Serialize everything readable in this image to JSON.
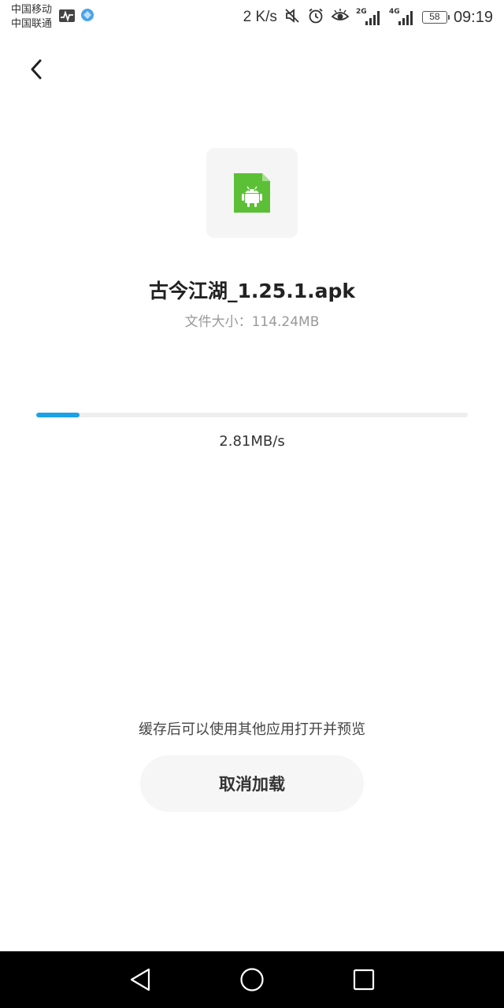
{
  "status_bar": {
    "carrier_1": "中国移动",
    "carrier_2": "中国联通",
    "net_speed": "2 K/s",
    "signal_1_label": "2G",
    "signal_2_label": "4G",
    "battery": "58",
    "time": "09:19",
    "icons": [
      "activity-monitor-icon",
      "browser-icon",
      "mute-icon",
      "alarm-icon",
      "eye-comfort-icon",
      "signal-icon",
      "battery-icon"
    ]
  },
  "file": {
    "name": "古今江湖_1.25.1.apk",
    "size_label": "文件大小：",
    "size_value": "114.24MB",
    "icon": "android-apk-icon",
    "icon_color": "#5bc036"
  },
  "download": {
    "progress": 0.1,
    "progress_color": "#1aa1e6",
    "speed": "2.81MB/s"
  },
  "hint": "缓存后可以使用其他应用打开并预览",
  "cancel_button": "取消加载",
  "nav": {
    "back": "back-triangle-icon",
    "home": "home-circle-icon",
    "recents": "recents-square-icon"
  }
}
